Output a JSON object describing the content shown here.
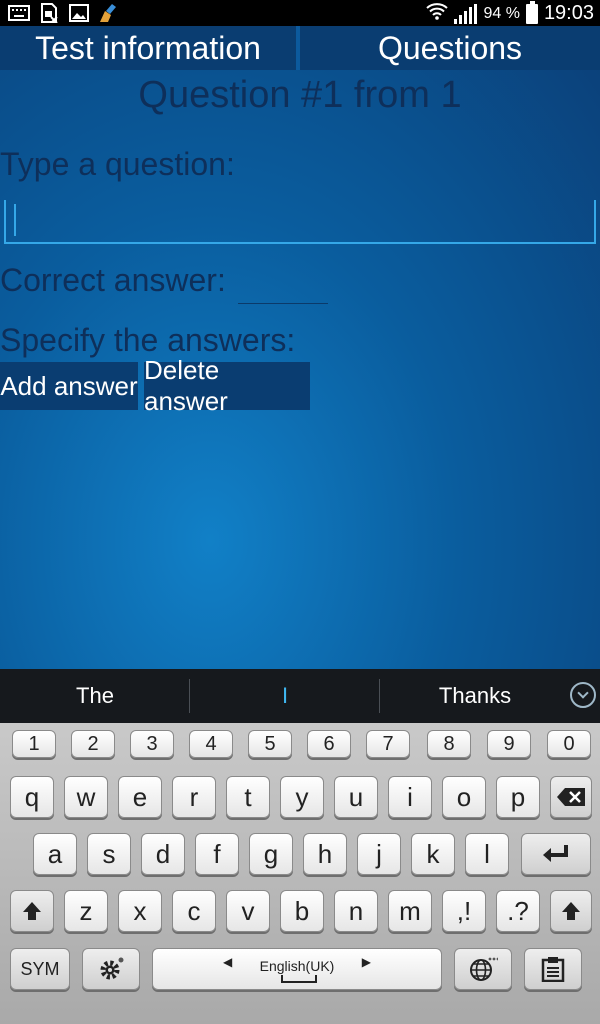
{
  "status_bar": {
    "battery_text": "94 %",
    "time": "19:03",
    "icons": [
      "keyboard-icon",
      "sim-off-icon",
      "gallery-icon",
      "cleaner-icon",
      "wifi-icon",
      "signal-icon",
      "battery-icon"
    ]
  },
  "tabs": [
    {
      "label": "Test information"
    },
    {
      "label": "Questions"
    }
  ],
  "form": {
    "title": "Question #1 from 1",
    "type_question_label": "Type a question:",
    "question_value": "",
    "correct_answer_label": "Correct answer:",
    "correct_answer_value": "",
    "specify_answers_label": "Specify the answers:",
    "add_answer_label": "Add answer",
    "delete_answer_label": "Delete answer"
  },
  "keyboard": {
    "suggestions": [
      "The",
      "I",
      "Thanks"
    ],
    "numbers": [
      "1",
      "2",
      "3",
      "4",
      "5",
      "6",
      "7",
      "8",
      "9",
      "0"
    ],
    "row1": [
      "q",
      "w",
      "e",
      "r",
      "t",
      "y",
      "u",
      "i",
      "o",
      "p"
    ],
    "row2": [
      "a",
      "s",
      "d",
      "f",
      "g",
      "h",
      "j",
      "k",
      "l"
    ],
    "row3": [
      "z",
      "x",
      "c",
      "v",
      "b",
      "n",
      "m"
    ],
    "comma_key": ",!",
    "period_key": ".?",
    "sym_label": "SYM",
    "space_label": "English(UK)"
  },
  "colors": {
    "tab_bg": "#0a3d71",
    "text_dark": "#0e2f5a",
    "accent": "#35a8e8"
  }
}
